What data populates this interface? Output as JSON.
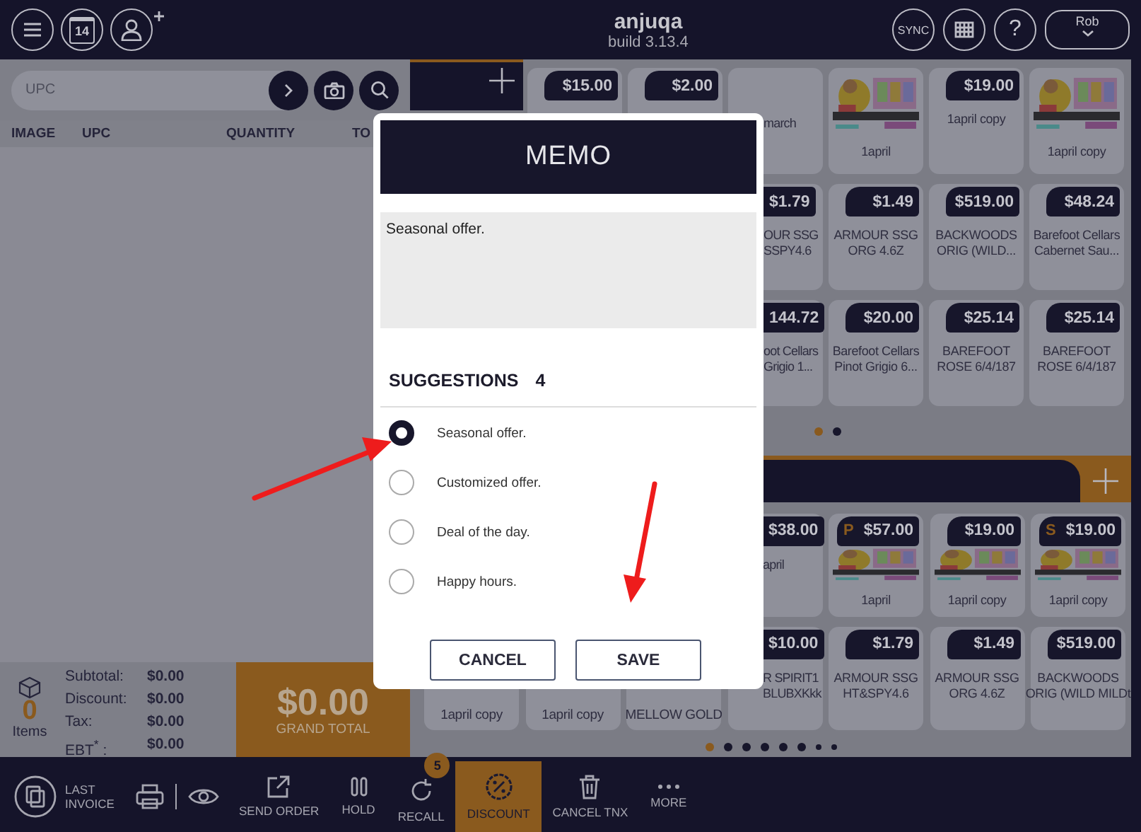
{
  "app": {
    "name": "anjuqa",
    "build": "build 3.13.4",
    "calendar_day": "14"
  },
  "topbar_right": {
    "sync": "SYNC",
    "help": "?",
    "user": "Rob"
  },
  "search": {
    "placeholder": "UPC"
  },
  "cart_columns": [
    "IMAGE",
    "UPC",
    "QUANTITY",
    "TO"
  ],
  "summary": {
    "count": "0",
    "count_label": "Items",
    "lines": [
      {
        "label": "Subtotal:",
        "value": "$0.00"
      },
      {
        "label": "Discount:",
        "value": "$0.00"
      },
      {
        "label": "Tax:",
        "value": "$0.00"
      },
      {
        "label": "EBT$^{*}$ :",
        "value": "$0.00"
      }
    ],
    "grand_total": "$0.00",
    "grand_total_label": "GRAND TOTAL"
  },
  "upper_products": {
    "rows": [
      [
        {
          "kind": "text",
          "price": "$15.00"
        },
        {
          "kind": "text",
          "price": "$2.00"
        },
        {
          "kind": "clipped",
          "name": "march"
        },
        {
          "kind": "picture",
          "name": "1april"
        },
        {
          "kind": "text",
          "price": "$19.00",
          "name": "1april copy"
        },
        {
          "kind": "picture",
          "name": "1april copy"
        }
      ],
      [
        "",
        "",
        {
          "kind": "clipped",
          "price": "$1.79",
          "name": "OUR SSG\nSSPY4.6"
        },
        {
          "kind": "text",
          "price": "$1.49",
          "name": "ARMOUR SSG\nORG 4.6Z"
        },
        {
          "kind": "text",
          "price": "$519.00",
          "name": "BACKWOODS\nORIG (WILD..."
        },
        {
          "kind": "text",
          "price": "$48.24",
          "name": "Barefoot Cellars\nCabernet Sau..."
        }
      ],
      [
        "",
        "",
        {
          "kind": "clipped",
          "price": "144.72",
          "name": "oot Cellars\nGrigio 1..."
        },
        {
          "kind": "text",
          "price": "$20.00",
          "name": "Barefoot Cellars\nPinot Grigio 6..."
        },
        {
          "kind": "text",
          "price": "$25.14",
          "name": "BAREFOOT\nROSE 6/4/187"
        },
        {
          "kind": "text",
          "price": "$25.14",
          "name": "BAREFOOT\nROSE 6/4/187"
        }
      ]
    ],
    "pages": [
      {
        "selected": true
      },
      {
        "selected": false
      }
    ]
  },
  "lower_products": {
    "rows": [
      [
        "",
        "",
        "",
        {
          "kind": "clipped",
          "price": "$38.00",
          "name": "april"
        },
        {
          "kind": "picture",
          "price": "$57.00",
          "flag": "P",
          "name": "1april"
        },
        {
          "kind": "picture",
          "price": "$19.00",
          "name": "1april copy"
        },
        {
          "kind": "picture",
          "price": "$19.00",
          "flag": "S",
          "name": "1april copy"
        }
      ],
      [
        {
          "kind": "name-only",
          "name": "1april copy"
        },
        {
          "kind": "name-only",
          "name": "1april copy"
        },
        {
          "kind": "name-only",
          "name": "MELLOW GOLD"
        },
        {
          "kind": "clipped",
          "price": "$10.00",
          "name": "R SPIRIT1\nBLUBXKkk"
        },
        {
          "kind": "text",
          "price": "$1.79",
          "name": "ARMOUR SSG\nHT&SPY4.6"
        },
        {
          "kind": "text",
          "price": "$1.49",
          "name": "ARMOUR SSG\nORG 4.6Z"
        },
        {
          "kind": "text",
          "price": "$519.00",
          "name": "BACKWOODS\nORIG (WILD MILDt"
        }
      ]
    ],
    "pages": [
      {
        "selected": true
      },
      {
        "selected": false
      },
      {
        "selected": false
      },
      {
        "selected": false
      },
      {
        "selected": false
      },
      {
        "selected": false
      },
      {
        "selected": false
      },
      {
        "selected": false
      }
    ]
  },
  "toolbar": [
    {
      "kind": "invoice",
      "label": "LAST INVOICE",
      "selected": false
    },
    {
      "kind": "printer",
      "selected": false
    },
    {
      "kind": "eye",
      "selected": false
    },
    {
      "kind": "share",
      "label": "SEND ORDER",
      "selected": false
    },
    {
      "kind": "pause",
      "label": "HOLD",
      "selected": false
    },
    {
      "kind": "recall",
      "label": "RECALL",
      "badge": "5",
      "selected": false
    },
    {
      "kind": "discount",
      "label": "DISCOUNT",
      "selected": true
    },
    {
      "kind": "trash",
      "label": "CANCEL TNX",
      "selected": false
    },
    {
      "kind": "more",
      "label": "MORE",
      "selected": false
    }
  ],
  "memo": {
    "title": "MEMO",
    "text": "Seasonal offer.",
    "suggestions_label": "SUGGESTIONS",
    "suggestions_count": "4",
    "suggestions": [
      {
        "text": "Seasonal offer.",
        "selected": true
      },
      {
        "text": "Customized offer.",
        "selected": false
      },
      {
        "text": "Deal of the day.",
        "selected": false
      },
      {
        "text": "Happy hours.",
        "selected": false
      }
    ],
    "buttons": [
      "CANCEL",
      "SAVE"
    ]
  }
}
